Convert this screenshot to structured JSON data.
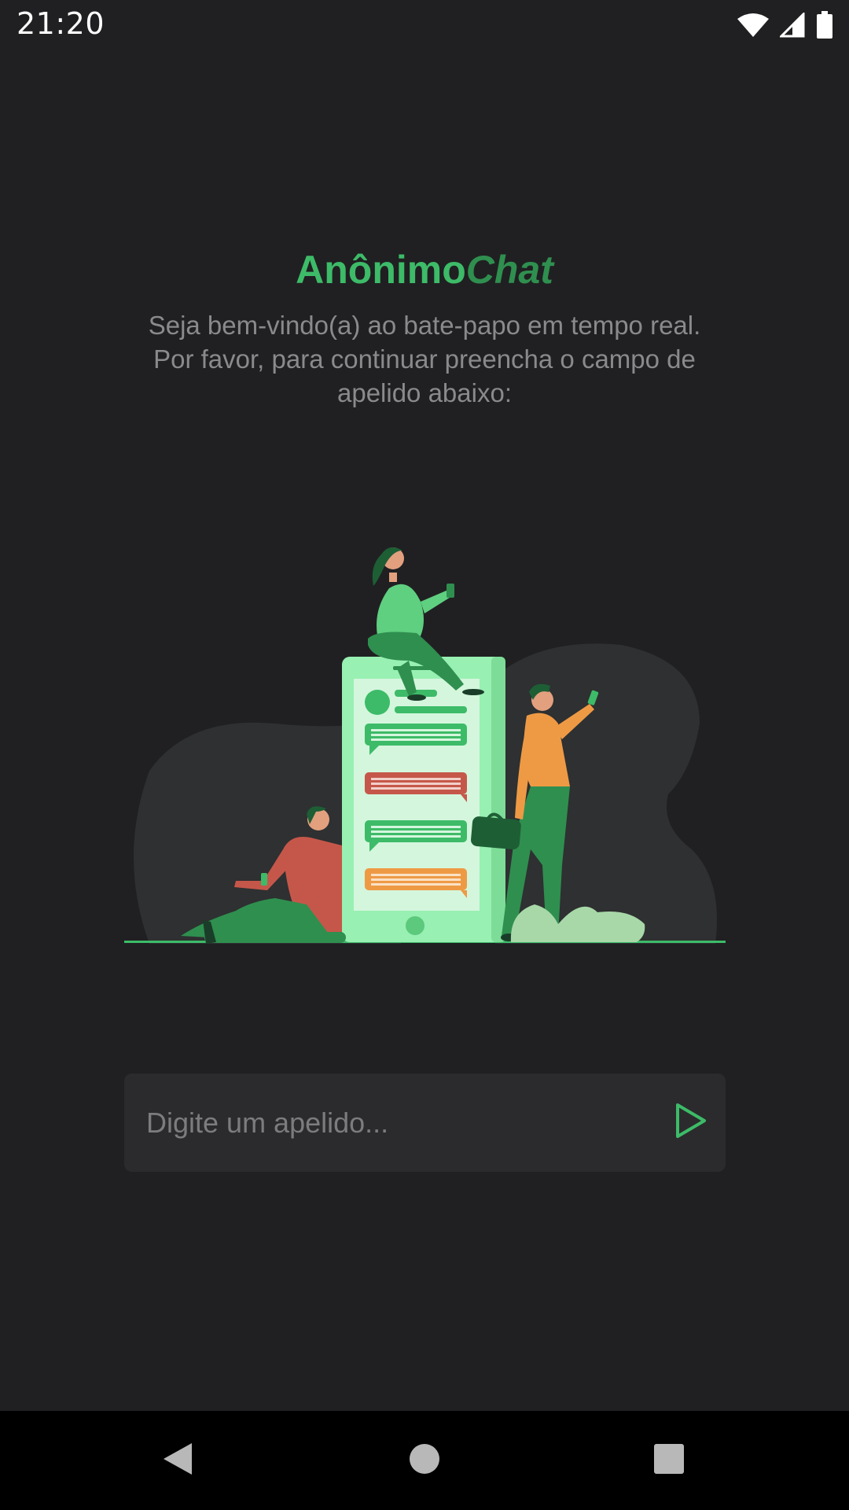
{
  "status_bar": {
    "time": "21:20",
    "icons": [
      "wifi-icon",
      "cell-signal-icon",
      "battery-icon"
    ]
  },
  "header": {
    "title_part1": "Anônimo",
    "title_part2": "Chat",
    "subtitle": "Seja bem-vindo(a) ao bate-papo em tempo real. Por favor, para continuar preencha o campo de apelido abaixo:"
  },
  "illustration": {
    "description_icon": "chat-people-illustration"
  },
  "nickname_form": {
    "value": "",
    "placeholder": "Digite um apelido...",
    "submit_icon": "play-send-icon"
  },
  "nav_bar": {
    "items": [
      "back-icon",
      "home-icon",
      "recents-icon"
    ]
  },
  "colors": {
    "background": "#202022",
    "accent": "#3dbb68",
    "accent_dark": "#2f8f4f",
    "input_bg": "#2b2b2d",
    "subtitle": "#8a8a8c"
  }
}
